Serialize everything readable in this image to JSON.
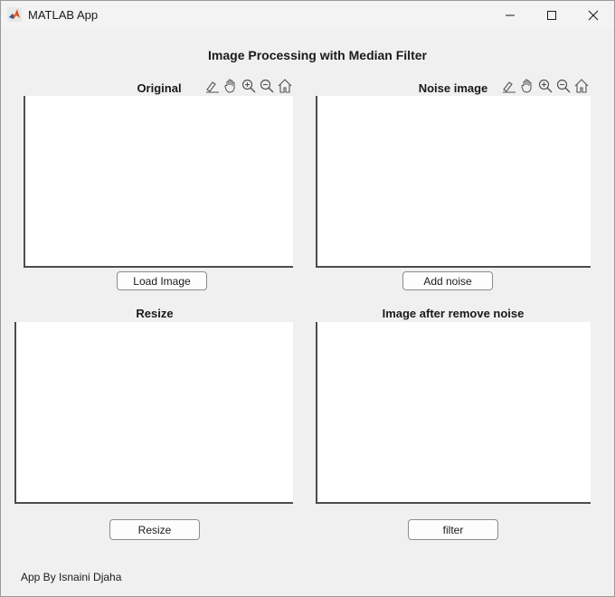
{
  "window": {
    "title": "MATLAB App",
    "controls": {
      "minimize": "minimize-icon",
      "maximize": "maximize-icon",
      "close": "close-icon"
    }
  },
  "app": {
    "title": "Image Processing with Median Filter",
    "footer": "App By Isnaini Djaha"
  },
  "axes": {
    "original": {
      "title": "Original"
    },
    "noise": {
      "title": "Noise image"
    },
    "resize": {
      "title": "Resize"
    },
    "filtered": {
      "title": "Image after remove noise"
    }
  },
  "buttons": {
    "load": "Load Image",
    "add_noise": "Add noise",
    "resize": "Resize",
    "filter": "filter"
  },
  "toolbar_icons": [
    "brush-icon",
    "pan-icon",
    "zoom-in-icon",
    "zoom-out-icon",
    "home-icon"
  ],
  "colors": {
    "background": "#f0f0f0",
    "axes_bg": "#ffffff",
    "axes_line": "#4d4d4d"
  }
}
